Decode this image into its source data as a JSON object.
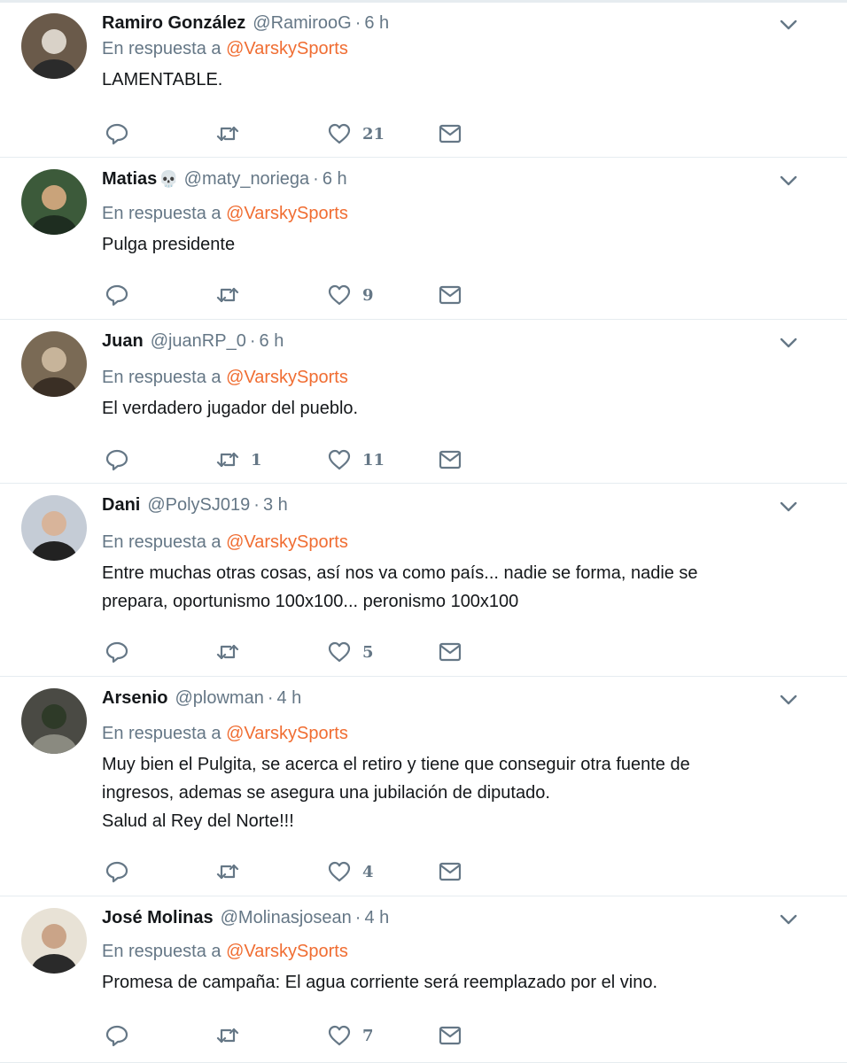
{
  "tweets": [
    {
      "name": "Ramiro González",
      "emoji": "",
      "handle": "@RamirooG",
      "time": "6 h",
      "reply_prefix": "En respuesta a",
      "reply_to": "@VarskySports",
      "text": [
        "LAMENTABLE."
      ],
      "replies": "",
      "retweets": "",
      "likes": "21",
      "avatar_colors": [
        "#6a5a4a",
        "#2b2b2b",
        "#d9d2c8"
      ]
    },
    {
      "name": "Matias",
      "emoji": "💀",
      "handle": "@maty_noriega",
      "time": "6 h",
      "reply_prefix": "En respuesta a",
      "reply_to": "@VarskySports",
      "text": [
        "Pulga presidente"
      ],
      "replies": "",
      "retweets": "",
      "likes": "9",
      "avatar_colors": [
        "#3c5a3a",
        "#1e2d20",
        "#c9a37a"
      ]
    },
    {
      "name": "Juan",
      "emoji": "",
      "handle": "@juanRP_0",
      "time": "6 h",
      "reply_prefix": "En respuesta a",
      "reply_to": "@VarskySports",
      "text": [
        "El verdadero jugador del pueblo."
      ],
      "replies": "",
      "retweets": "1",
      "likes": "11",
      "avatar_colors": [
        "#7a6a55",
        "#3a2f25",
        "#c7b49a"
      ]
    },
    {
      "name": "Dani",
      "emoji": "",
      "handle": "@PolySJ019",
      "time": "3 h",
      "reply_prefix": "En respuesta a",
      "reply_to": "@VarskySports",
      "text": [
        "Entre muchas otras cosas, así nos va como país... nadie se forma, nadie se",
        "prepara, oportunismo 100x100... peronismo 100x100"
      ],
      "replies": "",
      "retweets": "",
      "likes": "5",
      "avatar_colors": [
        "#c5ccd6",
        "#222222",
        "#d8b49a"
      ]
    },
    {
      "name": "Arsenio",
      "emoji": "",
      "handle": "@plowman",
      "time": "4 h",
      "reply_prefix": "En respuesta a",
      "reply_to": "@VarskySports",
      "text": [
        "Muy bien el Pulgita, se acerca el retiro y tiene que conseguir otra fuente de",
        "ingresos, ademas se asegura una jubilación de diputado.",
        "Salud al Rey del Norte!!!"
      ],
      "replies": "",
      "retweets": "",
      "likes": "4",
      "avatar_colors": [
        "#4a4a44",
        "#8a8a80",
        "#2e3a28"
      ]
    },
    {
      "name": "José Molinas",
      "emoji": "",
      "handle": "@Molinasjosean",
      "time": "4 h",
      "reply_prefix": "En respuesta a",
      "reply_to": "@VarskySports",
      "text": [
        "Promesa de campaña: El agua corriente será reemplazado por el vino."
      ],
      "replies": "",
      "retweets": "",
      "likes": "7",
      "avatar_colors": [
        "#e8e2d6",
        "#2a2a2a",
        "#caa488"
      ]
    }
  ],
  "icons": {
    "reply": "reply-icon",
    "retweet": "retweet-icon",
    "like": "heart-icon",
    "dm": "envelope-icon",
    "caret": "chevron-down-icon"
  },
  "colors": {
    "mention": "#f06d32",
    "secondary": "#657786",
    "text": "#14171a",
    "divider": "#e6ecf0"
  }
}
